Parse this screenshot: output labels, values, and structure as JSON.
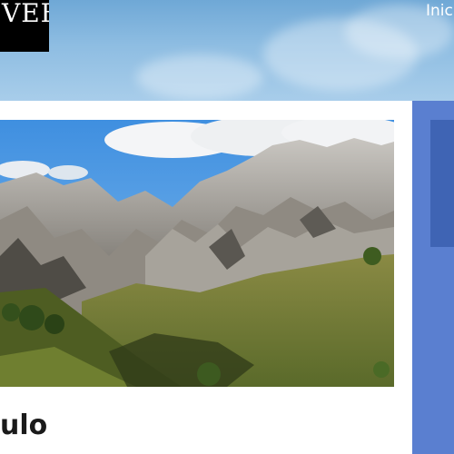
{
  "header": {
    "logo_text": "VEB",
    "nav": [
      {
        "label": "Inici"
      }
    ]
  },
  "article": {
    "title": "ulo",
    "image": {
      "alt": "mountain-landscape"
    }
  },
  "colors": {
    "sky_top": "#6fa8d6",
    "sky_bottom": "#a8cdea",
    "sidebar": "#5a7fd0",
    "sidebar_box": "#3f64b4",
    "logo_bg": "#000000"
  }
}
